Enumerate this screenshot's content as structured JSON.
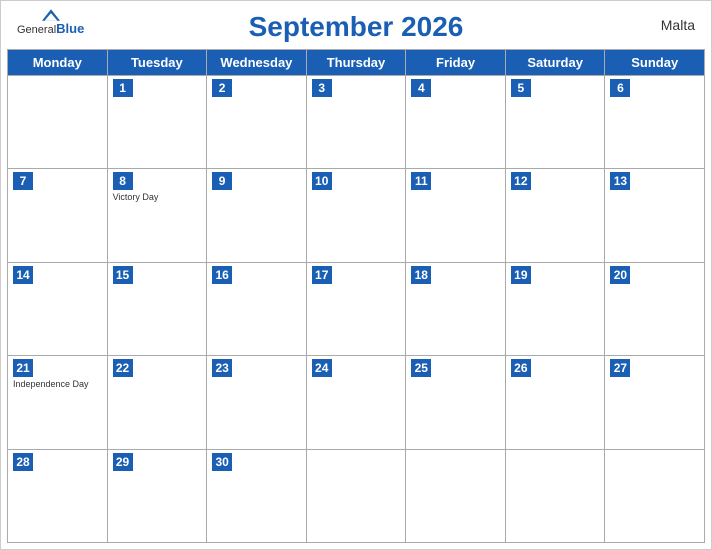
{
  "header": {
    "title": "September 2026",
    "country": "Malta",
    "logo_general": "General",
    "logo_blue": "Blue"
  },
  "days_of_week": [
    "Monday",
    "Tuesday",
    "Wednesday",
    "Thursday",
    "Friday",
    "Saturday",
    "Sunday"
  ],
  "weeks": [
    [
      {
        "date": "",
        "holiday": ""
      },
      {
        "date": "1",
        "holiday": ""
      },
      {
        "date": "2",
        "holiday": ""
      },
      {
        "date": "3",
        "holiday": ""
      },
      {
        "date": "4",
        "holiday": ""
      },
      {
        "date": "5",
        "holiday": ""
      },
      {
        "date": "6",
        "holiday": ""
      }
    ],
    [
      {
        "date": "7",
        "holiday": ""
      },
      {
        "date": "8",
        "holiday": "Victory Day"
      },
      {
        "date": "9",
        "holiday": ""
      },
      {
        "date": "10",
        "holiday": ""
      },
      {
        "date": "11",
        "holiday": ""
      },
      {
        "date": "12",
        "holiday": ""
      },
      {
        "date": "13",
        "holiday": ""
      }
    ],
    [
      {
        "date": "14",
        "holiday": ""
      },
      {
        "date": "15",
        "holiday": ""
      },
      {
        "date": "16",
        "holiday": ""
      },
      {
        "date": "17",
        "holiday": ""
      },
      {
        "date": "18",
        "holiday": ""
      },
      {
        "date": "19",
        "holiday": ""
      },
      {
        "date": "20",
        "holiday": ""
      }
    ],
    [
      {
        "date": "21",
        "holiday": "Independence Day"
      },
      {
        "date": "22",
        "holiday": ""
      },
      {
        "date": "23",
        "holiday": ""
      },
      {
        "date": "24",
        "holiday": ""
      },
      {
        "date": "25",
        "holiday": ""
      },
      {
        "date": "26",
        "holiday": ""
      },
      {
        "date": "27",
        "holiday": ""
      }
    ],
    [
      {
        "date": "28",
        "holiday": ""
      },
      {
        "date": "29",
        "holiday": ""
      },
      {
        "date": "30",
        "holiday": ""
      },
      {
        "date": "",
        "holiday": ""
      },
      {
        "date": "",
        "holiday": ""
      },
      {
        "date": "",
        "holiday": ""
      },
      {
        "date": "",
        "holiday": ""
      }
    ]
  ]
}
